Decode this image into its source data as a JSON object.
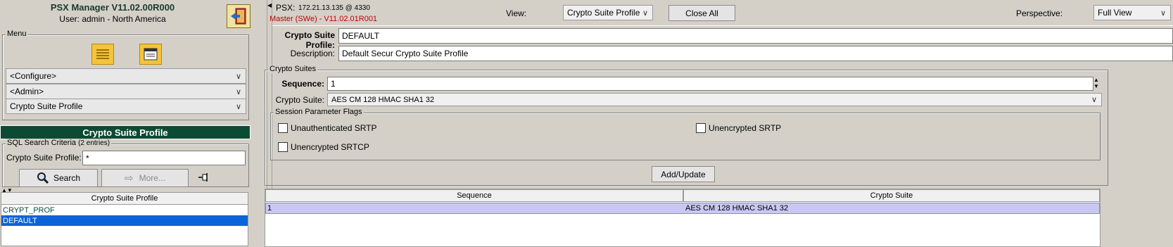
{
  "app": {
    "title": "PSX Manager V11.02.00R000",
    "user_label": "User:",
    "user_value": "admin - North America"
  },
  "menu": {
    "legend": "Menu",
    "dropdowns": [
      "<Configure>",
      "<Admin>",
      "Crypto Suite Profile"
    ]
  },
  "search": {
    "section_title": "Crypto Suite Profile",
    "legend": "SQL Search Criteria",
    "legend_count": "(2 entries)",
    "field_label": "Crypto Suite Profile:",
    "field_value": "*",
    "search_button": "Search",
    "more_button": "More..."
  },
  "list": {
    "header": "Crypto Suite Profile",
    "items": [
      "CRYPT_PROF",
      "DEFAULT"
    ],
    "selected_index": 1
  },
  "topbar": {
    "psx_label": "PSX:",
    "psx_value": "172.21.13.135 @ 4330",
    "master_label": "Master (SWe) - V11.02.01R001",
    "view_label": "View:",
    "view_value": "Crypto Suite Profile",
    "close_all": "Close All",
    "perspective_label": "Perspective:",
    "perspective_value": "Full View"
  },
  "form": {
    "profile_label": "Crypto Suite Profile:",
    "profile_value": "DEFAULT",
    "description_label": "Description:",
    "description_value": "Default Secur Crypto Suite Profile"
  },
  "suites": {
    "legend": "Crypto Suites",
    "sequence_label": "Sequence:",
    "sequence_value": "1",
    "suite_label": "Crypto Suite:",
    "suite_value": "AES CM 128 HMAC SHA1 32",
    "flags_legend": "Session Parameter Flags",
    "flags": {
      "unauth_srtp": "Unauthenticated SRTP",
      "unenc_srtp": "Unencrypted SRTP",
      "unenc_srtcp": "Unencrypted SRTCP"
    },
    "add_update": "Add/Update"
  },
  "table": {
    "headers": [
      "Sequence",
      "Crypto Suite"
    ],
    "rows": [
      [
        "1",
        "AES CM 128 HMAC SHA1 32"
      ]
    ]
  }
}
